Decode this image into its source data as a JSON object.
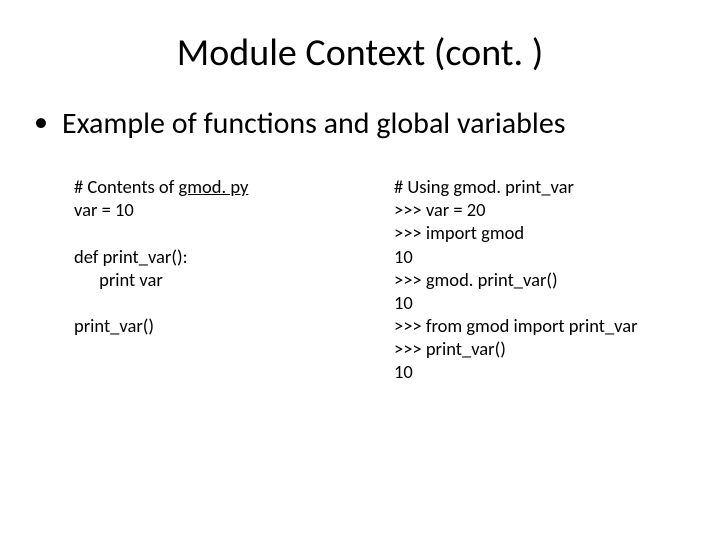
{
  "title": "Module Context (cont. )",
  "bullet": "Example of functions and global variables",
  "left": {
    "l1a": "# Contents of ",
    "l1b": "gmod. py",
    "l2": "var = 10",
    "l3": "",
    "l4": "def print_var():",
    "l5": "      print var",
    "l6": "",
    "l7": "print_var()"
  },
  "right": {
    "r1": "# Using gmod. print_var",
    "r2": ">>> var = 20",
    "r3": ">>> import gmod",
    "r4": "10",
    "r5": ">>> gmod. print_var()",
    "r6": "10",
    "r7": ">>> from gmod import print_var",
    "r8": ">>> print_var()",
    "r9": "10"
  }
}
